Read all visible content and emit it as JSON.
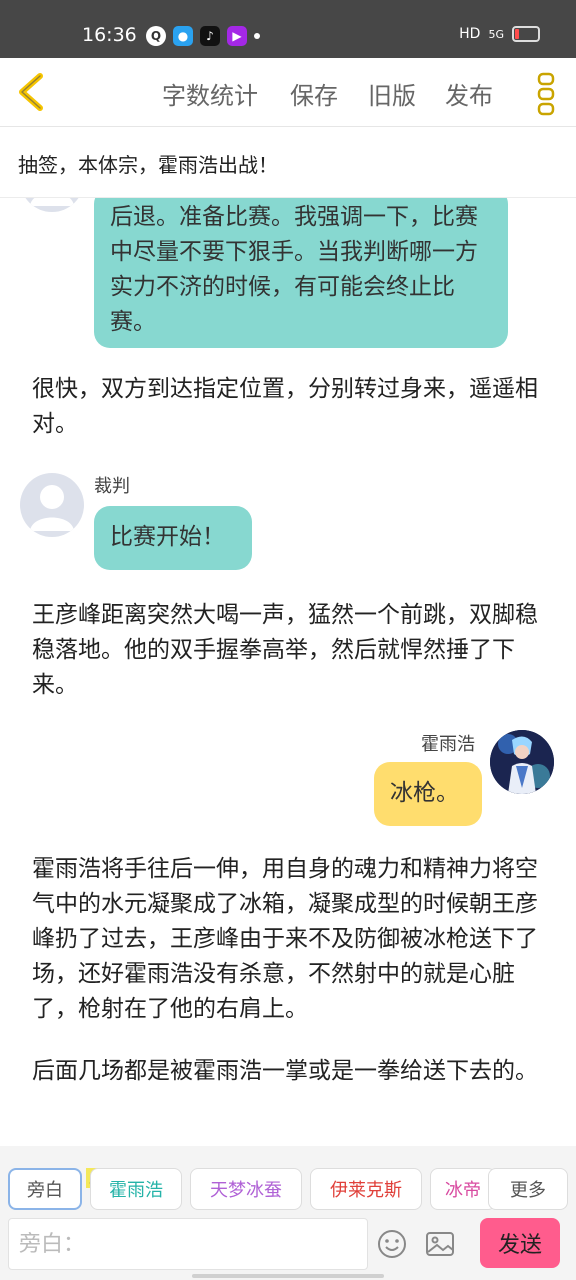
{
  "status": {
    "time": "16:36",
    "network": "HD",
    "signal": "5G"
  },
  "toolbar": {
    "word_count": "字数统计",
    "save": "保存",
    "old_version": "旧版",
    "publish": "发布"
  },
  "chapter_title": "抽签，本体宗，霍雨浩出战！",
  "messages": {
    "referee_bubble_1": "后退。准备比赛。我强调一下，比赛中尽量不要下狠手。当我判断哪一方实力不济的时候，有可能会终止比赛。",
    "narration_1": "很快，双方到达指定位置，分别转过身来，遥遥相对。",
    "referee_name": "裁判",
    "referee_bubble_2": "比赛开始！",
    "narration_2": "王彦峰距离突然大喝一声，猛然一个前跳，双脚稳稳落地。他的双手握拳高举，然后就悍然捶了下来。",
    "huo_name": "霍雨浩",
    "huo_bubble": "冰枪。",
    "narration_3": "霍雨浩将手往后一伸，用自身的魂力和精神力将空气中的水元凝聚成了冰箱，凝聚成型的时候朝王彦峰扔了过去，王彦峰由于来不及防御被冰枪送下了场，还好霍雨浩没有杀意，不然射中的就是心脏了，枪射在了他的右肩上。",
    "narration_4": "后面几场都是被霍雨浩一掌或是一拳给送下去的。"
  },
  "roles": {
    "narrator": "旁白",
    "main_badge": "主",
    "huo": "霍雨浩",
    "tianmeng": "天梦冰蚕",
    "elikes": "伊莱克斯",
    "bingdi": "冰帝",
    "more": "更多"
  },
  "input": {
    "placeholder": "旁白："
  },
  "send_label": "发送",
  "colors": {
    "accent_yellow": "#f5c400",
    "teal_bubble": "#87d8d0",
    "yellow_bubble": "#ffdd6e",
    "send_pink": "#ff5c8d"
  }
}
